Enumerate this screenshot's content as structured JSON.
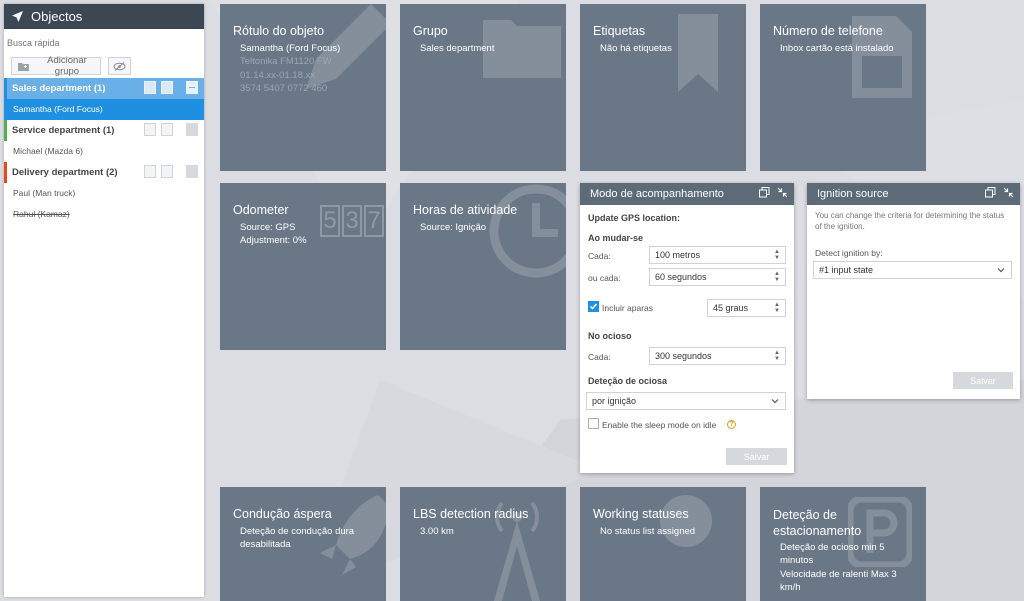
{
  "sidebar": {
    "title": "Objectos",
    "search_placeholder": "Busca rápida",
    "add_group_label": "Adicionar grupo",
    "groups": [
      {
        "label": "Sales department (1)",
        "units": [
          "Samantha (Ford Focus)"
        ],
        "color": "#1e8fe1"
      },
      {
        "label": "Service department (1)",
        "units": [
          "Michael (Mazda 6)"
        ],
        "color": "#4caf50"
      },
      {
        "label": "Delivery department (2)",
        "units": [
          "Paul (Man truck)",
          "Rahul (Kamaz)"
        ],
        "color": "#e64a19"
      }
    ]
  },
  "tiles": {
    "object_label": {
      "title": "Rótulo do objeto",
      "lines": [
        "Samantha (Ford Focus)",
        "Teltonika FM1120 FW",
        "01.14.xx-01.18.xx",
        "3574 5407 0772 460"
      ]
    },
    "group": {
      "title": "Grupo",
      "value": "Sales department"
    },
    "tags": {
      "title": "Etiquetas",
      "value": "Não há etiquetas"
    },
    "phone": {
      "title": "Número de telefone",
      "value": "Inbox cartão está instalado"
    },
    "odometer": {
      "title": "Odometer",
      "source": "Source: GPS",
      "adjustment": "Adjustment: 0%",
      "digits": [
        "5",
        "3",
        "7"
      ]
    },
    "engine_hours": {
      "title": "Horas de atividade",
      "source": "Source: Ignição"
    },
    "harsh_driving": {
      "title": "Condução áspera",
      "value": "Deteção de condução dura desabilitada"
    },
    "lbs": {
      "title": "LBS detection radius",
      "value": "3.00 km"
    },
    "working_statuses": {
      "title": "Working statuses",
      "value": "No status list assigned"
    },
    "parking": {
      "title": "Deteção de estacionamento",
      "line1": "Deteção de ocioso min 5 minutos",
      "line2": "Velocidade de ralenti Max 3 km/h"
    }
  },
  "tracking_panel": {
    "title": "Modo de acompanhamento",
    "update_label": "Update GPS location:",
    "on_move_label": "Ao mudar-se",
    "every_label": "Cada:",
    "every_value": "100  metros",
    "or_every_label": "ou cada:",
    "or_every_value": "60  segundos",
    "include_turns_label": "Incluir aparas",
    "include_turns_checked": true,
    "degrees_value": "45  graus",
    "idle_label": "No ocioso",
    "idle_every_label": "Cada:",
    "idle_every_value": "300  segundos",
    "idle_detection_label": "Deteção de ociosa",
    "idle_detection_value": "por ignição",
    "sleep_mode_label": "Enable the sleep mode on idle",
    "sleep_mode_checked": false,
    "save_label": "Salvar"
  },
  "ignition_panel": {
    "title": "Ignition source",
    "description": "You can change the criteria for determining the status of the ignition.",
    "detect_label": "Detect ignition by:",
    "detect_value": "#1 input state",
    "save_label": "Salvar"
  }
}
